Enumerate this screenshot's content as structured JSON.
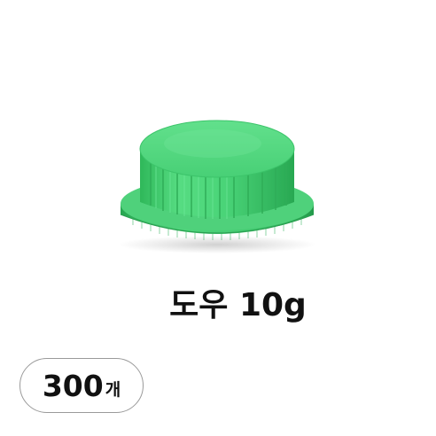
{
  "product": {
    "title": "도우 10g",
    "image_icon": "green-bottle-cap",
    "cap_color": "#3ccb6a"
  },
  "badge": {
    "quantity": "300",
    "unit": "개"
  }
}
